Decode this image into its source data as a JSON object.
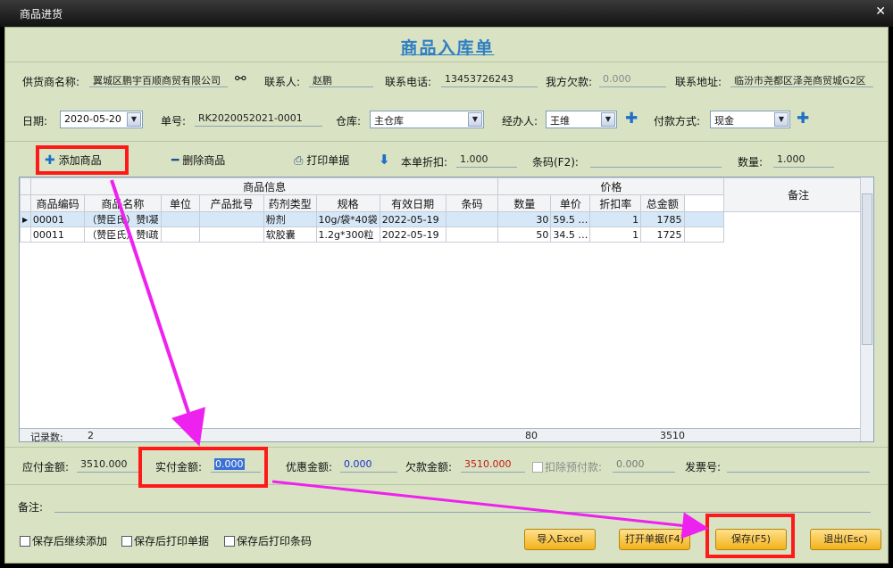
{
  "window": {
    "title": "商品进货",
    "close": "✕"
  },
  "heading": "商品入库单",
  "supplier": {
    "label": "供货商名称:",
    "value": "翼城区鹏宇百顺商贸有限公司"
  },
  "contact": {
    "label": "联系人:",
    "value": "赵鹏"
  },
  "phone": {
    "label": "联系电话:",
    "value": "13453726243"
  },
  "owed": {
    "label": "我方欠款:",
    "value": "0.000"
  },
  "address": {
    "label": "联系地址:",
    "value": "临汾市尧都区泽尧商贸城G2区"
  },
  "date": {
    "label": "日期:",
    "value": "2020-05-20"
  },
  "order_no": {
    "label": "单号:",
    "value": "RK2020052021-0001"
  },
  "warehouse": {
    "label": "仓库:",
    "value": "主仓库"
  },
  "handler": {
    "label": "经办人:",
    "value": "王维"
  },
  "payment": {
    "label": "付款方式:",
    "value": "现金"
  },
  "toolbar": {
    "add": "添加商品",
    "delete": "删除商品",
    "print": "打印单据",
    "discount_label": "本单折扣:",
    "discount_value": "1.000",
    "barcode_label": "条码(F2):",
    "qty_label": "数量:",
    "qty_value": "1.000"
  },
  "table": {
    "group_goods": "商品信息",
    "group_price": "价格",
    "remark_header": "备注",
    "columns": [
      "商品编码",
      "商品名称",
      "单位",
      "产品批号",
      "药剂类型",
      "规格",
      "有效日期",
      "条码",
      "数量",
      "单价",
      "折扣率",
      "总金额"
    ],
    "rows": [
      [
        "00001",
        "（赞臣氏）赞I凝",
        "",
        "",
        "粉剂",
        "10g/袋*40袋",
        "2022-05-19",
        "",
        "30",
        "59.5 …",
        "1",
        "1785"
      ],
      [
        "00011",
        "（赞臣氏）赞I疏",
        "",
        "",
        "软胶囊",
        "1.2g*300粒",
        "2022-05-19",
        "",
        "50",
        "34.5 …",
        "1",
        "1725"
      ]
    ],
    "footer_label": "记录数:",
    "footer_count": "2",
    "footer_qty": "80",
    "footer_total": "3510"
  },
  "payable": {
    "label": "应付金额:",
    "value": "3510.000"
  },
  "actual": {
    "label": "实付金额:",
    "value": "0.000"
  },
  "discount_amt": {
    "label": "优惠金额:",
    "value": "0.000"
  },
  "debt": {
    "label": "欠款金额:",
    "value": "3510.000"
  },
  "deduct": {
    "label": "扣除预付款:",
    "value": "0.000"
  },
  "invoice": {
    "label": "发票号:",
    "value": ""
  },
  "remark": {
    "label": "备注:",
    "value": ""
  },
  "checks": [
    "保存后继续添加",
    "保存后打印单据",
    "保存后打印条码"
  ],
  "buttons": {
    "import": "导入Excel",
    "open": "打开单据(F4)",
    "save": "保存(F5)",
    "exit": "退出(Esc)"
  },
  "colors": {
    "accent": "#2f7fc1",
    "panel": "#d9e3c3",
    "annotation": "#ff1a1a",
    "arrow": "#ee22ee"
  }
}
